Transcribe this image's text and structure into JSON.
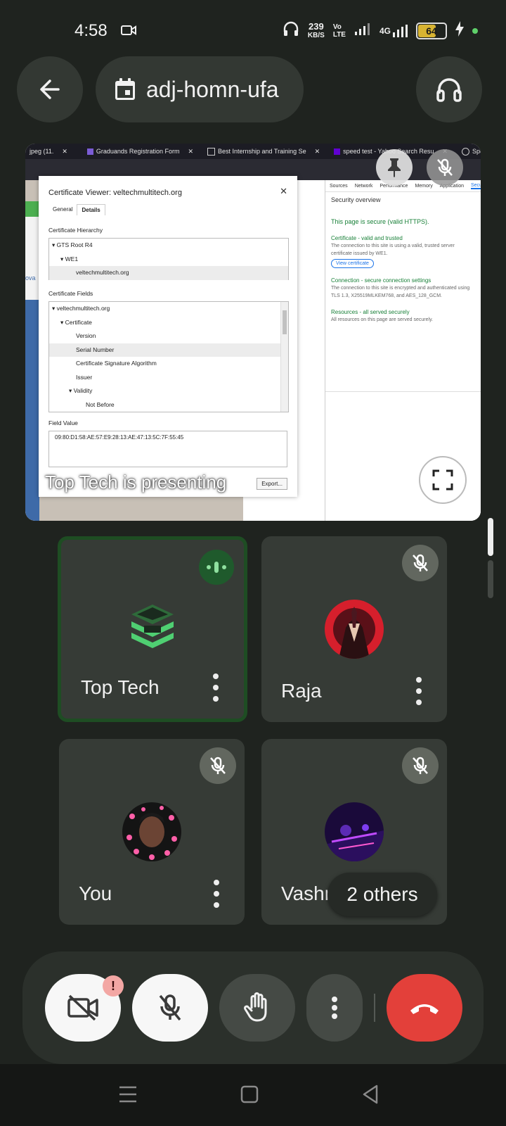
{
  "status_bar": {
    "time": "4:58",
    "speed_value": "239",
    "speed_unit": "KB/S",
    "volte_line1": "Vo",
    "volte_line2": "LTE",
    "network_gen": "4G",
    "battery_level": "64",
    "icons": [
      "video-camera-icon",
      "headphones-icon",
      "signal-icon",
      "lightning-icon"
    ]
  },
  "header": {
    "meeting_code": "adj-homn-ufa",
    "icons": [
      "back-arrow-icon",
      "calendar-icon",
      "headphones-icon"
    ]
  },
  "presentation": {
    "label": "Top Tech is presenting",
    "browser_tabs": [
      "jpeg (11.",
      "Graduands Registration Form",
      "Best Internship and Training Se",
      "speed test - Yahoo Search Resu",
      "Speedtest by Ookla"
    ],
    "certificate_viewer": {
      "title": "Certificate Viewer: veltechmultitech.org",
      "tabs": [
        "General",
        "Details"
      ],
      "hierarchy_heading": "Certificate Hierarchy",
      "hierarchy": [
        "GTS Root R4",
        "WE1",
        "veltechmultitech.org"
      ],
      "fields_heading": "Certificate Fields",
      "fields": [
        "veltechmultitech.org",
        "Certificate",
        "Version",
        "Serial Number",
        "Certificate Signature Algorithm",
        "Issuer",
        "Validity",
        "Not Before"
      ],
      "field_value_heading": "Field Value",
      "field_value": "09:80:D1:58:AE:57:E9:28:13:AE:47:13:5C:7F:55:45",
      "export_label": "Export..."
    },
    "devtools": {
      "tabs": [
        "Sources",
        "Network",
        "Performance",
        "Memory",
        "Application",
        "Security"
      ],
      "heading": "Security overview",
      "secure_text": "This page is secure (valid HTTPS).",
      "cert_line": "Certificate - valid and trusted",
      "cert_desc": "The connection to this site is using a valid, trusted server certificate issued by WE1.",
      "view_cert": "View certificate",
      "conn_line": "Connection - secure connection settings",
      "conn_desc": "The connection to this site is encrypted and authenticated using TLS 1.3, X25519MLKEM768, and AES_128_GCM.",
      "res_line": "Resources - all served securely",
      "res_desc": "All resources on this page are served securely."
    },
    "side_text": "ova"
  },
  "participants": [
    {
      "name": "Top Tech",
      "state": "speaking"
    },
    {
      "name": "Raja",
      "state": "muted"
    },
    {
      "name": "You",
      "state": "muted"
    },
    {
      "name": "Vashna",
      "state": "muted"
    }
  ],
  "others_label": "2 others",
  "controls": {
    "camera_warning": "!",
    "buttons": [
      "camera-off",
      "mic-off",
      "raise-hand",
      "more-options",
      "end-call"
    ]
  },
  "colors": {
    "background": "#1f231f",
    "tile": "#363b36",
    "speaking_border": "#1e4d23",
    "end_call": "#e3403a",
    "battery": "#d8b432"
  }
}
